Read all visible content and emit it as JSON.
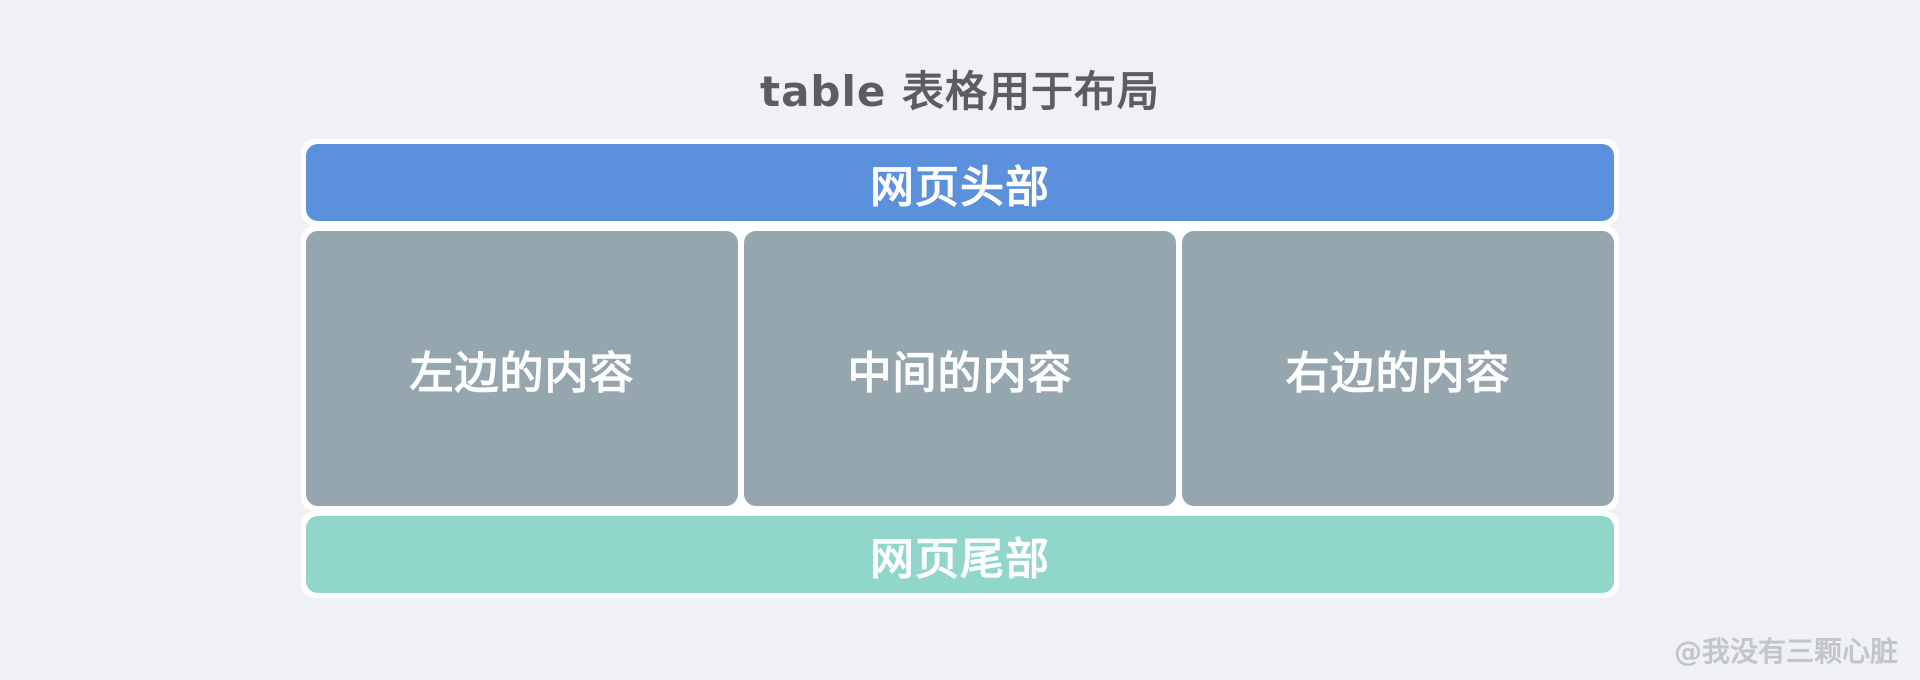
{
  "title": "table 表格用于布局",
  "layout": {
    "header": "网页头部",
    "columns": [
      "左边的内容",
      "中间的内容",
      "右边的内容"
    ],
    "footer": "网页尾部"
  },
  "watermark": "@我没有三颗心脏",
  "colors": {
    "background": "#f0f1f5",
    "header": "#5b91dc",
    "content": "#95a6af",
    "footer": "#90d6cb",
    "border": "#ffffff",
    "title": "#5b5d63",
    "watermark": "#c2c5cc"
  }
}
